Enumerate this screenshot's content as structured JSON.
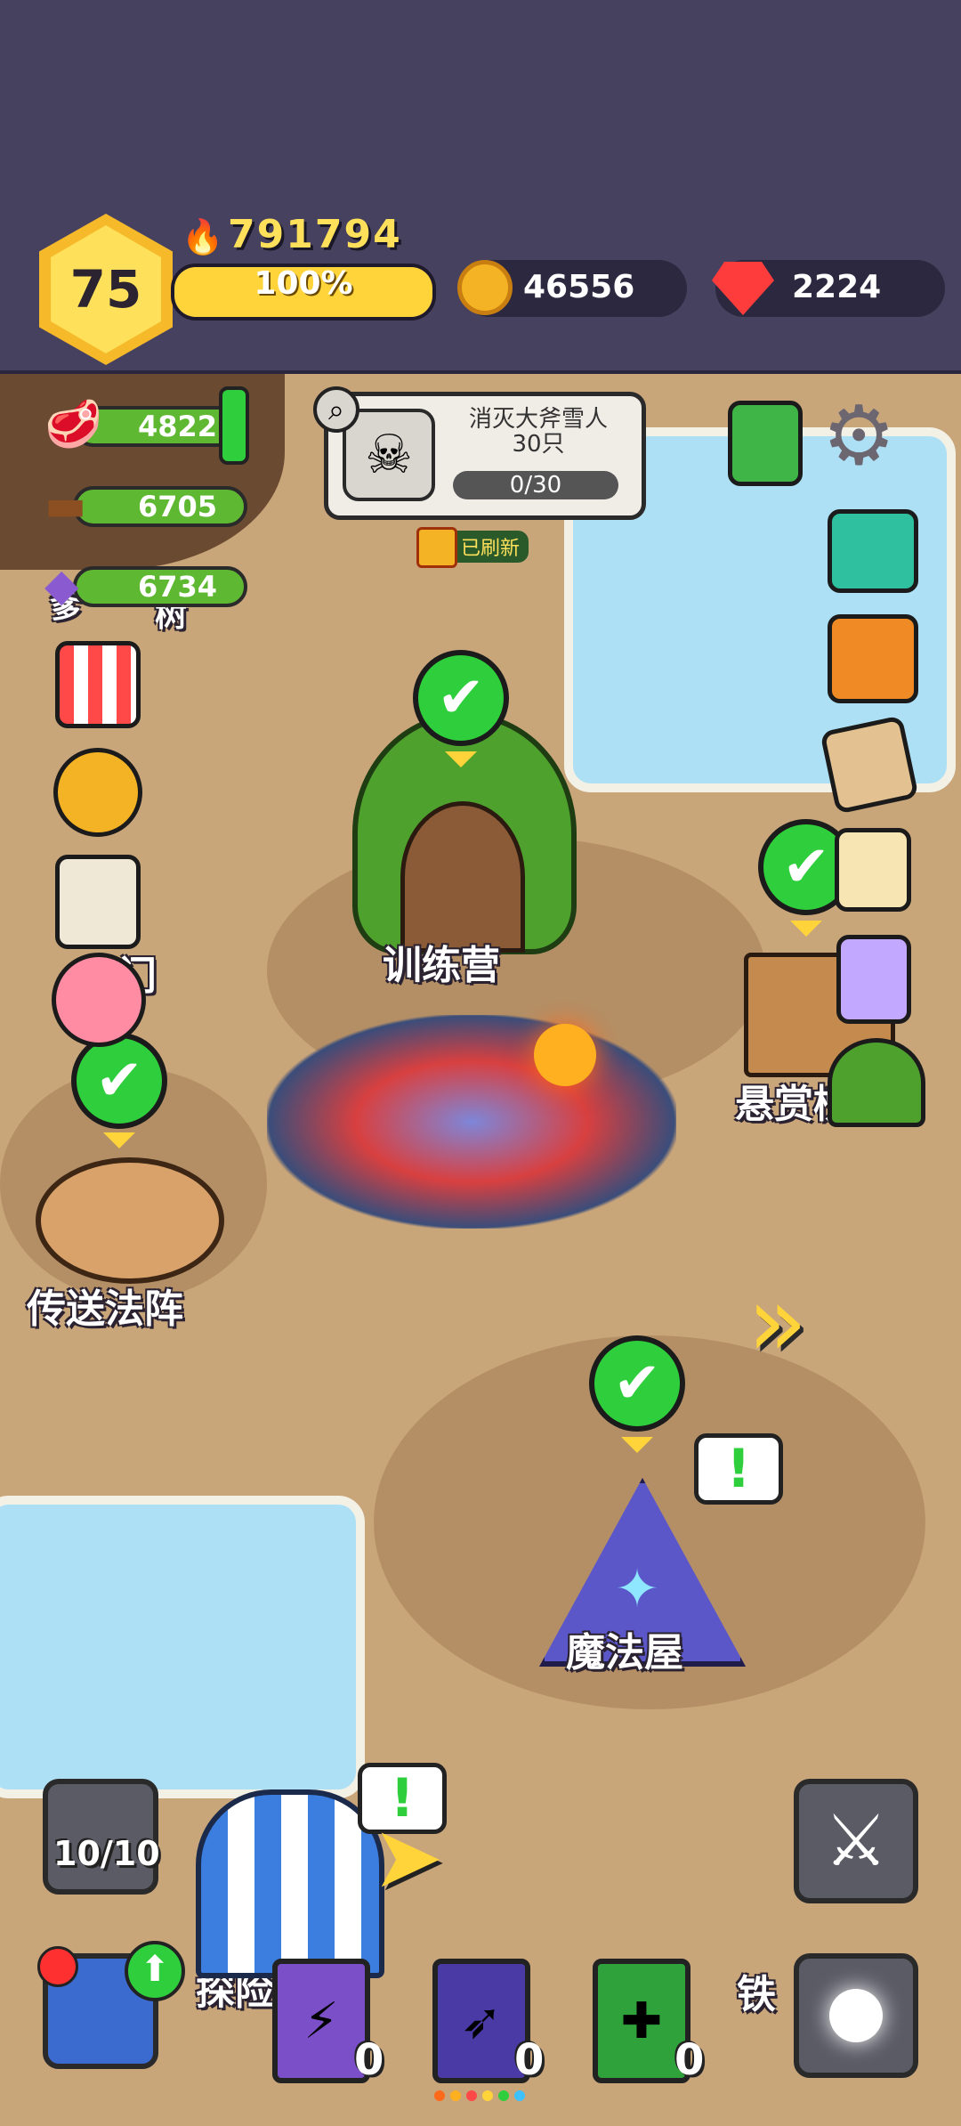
{
  "header": {
    "level": "75",
    "power": "791794",
    "xp_percent_label": "100%",
    "xp_fraction": 1.0,
    "coins": "46556",
    "gems": "2224"
  },
  "resources": {
    "meat": "4822",
    "wood": "6705",
    "ore": "6734"
  },
  "quest": {
    "title": "消灭大斧雪人\n30只",
    "progress": "0/30",
    "refresh_label": "已刷新"
  },
  "buildings": {
    "training_camp": "训练营",
    "bounty_board": "悬赏榜",
    "teleport_array": "传送法阵",
    "magic_house": "魔法屋",
    "partial_left_top": "爹",
    "partial_gate": "门",
    "partial_tree": "树",
    "partial_explore": "探险",
    "partial_iron": "铁"
  },
  "team": {
    "slots": "10/10"
  },
  "books": [
    {
      "count": "0",
      "color": "#7a4fc7",
      "icon": "lightning-icon"
    },
    {
      "count": "0",
      "color": "#4a3aa5",
      "icon": "wing-icon"
    },
    {
      "count": "0",
      "color": "#2fa23c",
      "icon": "cross-icon"
    }
  ],
  "colors": {
    "topbar": "#474160",
    "map_ground": "#c9a57a",
    "check_green": "#2fce3c",
    "water": "#aee0f5"
  }
}
